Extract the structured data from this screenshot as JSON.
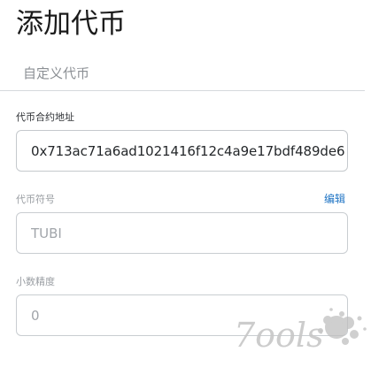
{
  "header": {
    "title": "添加代币"
  },
  "tabs": [
    {
      "label": "自定义代币"
    }
  ],
  "form": {
    "contract_address": {
      "label": "代币合约地址",
      "value": "0x713ac71a6ad1021416f12c4a9e17bdf489de6"
    },
    "symbol": {
      "label": "代币符号",
      "edit_label": "编辑",
      "value": "TUBI"
    },
    "decimals": {
      "label": "小数精度",
      "value": "0"
    }
  },
  "watermark": {
    "text": "7ools",
    "icon": "ink-splash"
  },
  "colors": {
    "link": "#1f74c4",
    "border": "#c5c9cd",
    "muted_text": "#9a9ea3"
  }
}
